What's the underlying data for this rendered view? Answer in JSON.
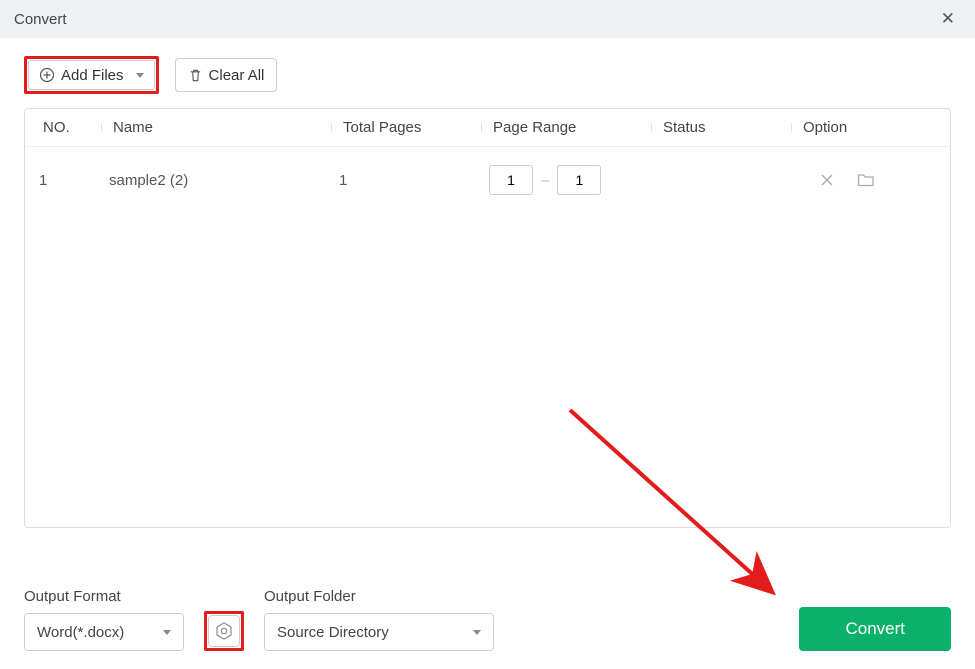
{
  "window": {
    "title": "Convert"
  },
  "toolbar": {
    "add_files_label": "Add Files",
    "clear_all_label": "Clear All"
  },
  "table": {
    "headers": {
      "no": "NO.",
      "name": "Name",
      "total_pages": "Total Pages",
      "page_range": "Page Range",
      "status": "Status",
      "option": "Option"
    },
    "rows": [
      {
        "no": "1",
        "name": "sample2 (2)",
        "total_pages": "1",
        "range_from": "1",
        "range_to": "1",
        "status": ""
      }
    ]
  },
  "footer": {
    "output_format_label": "Output Format",
    "output_format_value": "Word(*.docx)",
    "output_folder_label": "Output Folder",
    "output_folder_value": "Source Directory",
    "convert_label": "Convert"
  },
  "annotations": {
    "highlights": [
      "add-files-button",
      "format-settings-button"
    ],
    "arrow_target": "convert-button"
  }
}
